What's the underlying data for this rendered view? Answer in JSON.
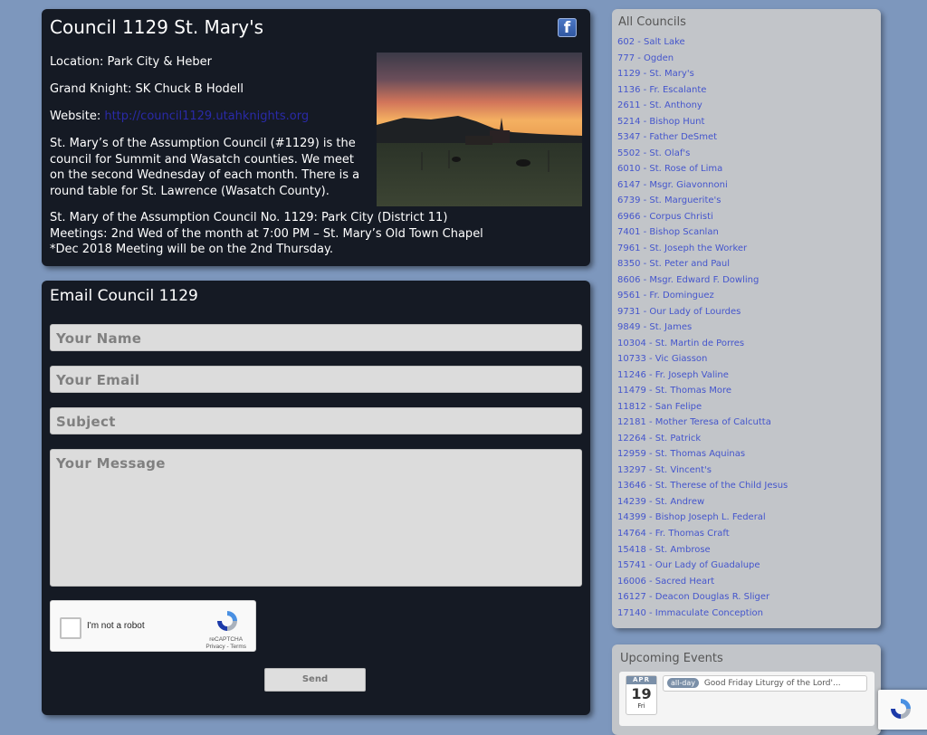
{
  "council": {
    "title": "Council 1129 St. Mary's",
    "location_label": "Location:",
    "location": "Park City & Heber",
    "gk_label": "Grand Knight:",
    "grand_knight": "SK Chuck B Hodell",
    "website_label": "Website:",
    "website": "http://council1129.utahknights.org",
    "description": "St. Mary’s of the Assumption Council (#1129) is the council for Summit and Wasatch counties. We meet on the second Wednesday of each month. There is a round table for St. Lawrence (Wasatch County).",
    "meeting_lines": [
      "St. Mary of the Assumption Council No. 1129:  Park City (District 11)",
      "Meetings: 2nd Wed of the month at 7:00 PM – St. Mary’s Old Town Chapel",
      "*Dec 2018 Meeting will be on the 2nd Thursday."
    ],
    "social_icon": "facebook-icon"
  },
  "form": {
    "title": "Email Council 1129",
    "name_placeholder": "Your Name",
    "email_placeholder": "Your Email",
    "subject_placeholder": "Subject",
    "message_placeholder": "Your Message",
    "captcha_label": "I'm not a robot",
    "captcha_brand": "reCAPTCHA",
    "captcha_links": "Privacy - Terms",
    "send_label": "Send"
  },
  "sidebar": {
    "title": "All Councils",
    "councils": [
      "602 - Salt Lake",
      "777 - Ogden",
      "1129 - St. Mary's",
      "1136 - Fr. Escalante",
      "2611 - St. Anthony",
      "5214 - Bishop Hunt",
      "5347 - Father DeSmet",
      "5502 - St. Olaf's",
      "6010 - St. Rose of Lima",
      "6147 - Msgr. Giavonnoni",
      "6739 - St. Marguerite's",
      "6966 - Corpus Christi",
      "7401 - Bishop Scanlan",
      "7961 - St. Joseph the Worker",
      "8350 - St. Peter and Paul",
      "8606 - Msgr. Edward F. Dowling",
      "9561 - Fr. Dominguez",
      "9731 - Our Lady of Lourdes",
      "9849 - St. James",
      "10304 - St. Martin de Porres",
      "10733 - Vic Giasson",
      "11246 - Fr. Joseph Valine",
      "11479 - St. Thomas More",
      "11812 - San Felipe",
      "12181 - Mother Teresa of Calcutta",
      "12264 - St. Patrick",
      "12959 - St. Thomas Aquinas",
      "13297 - St. Vincent's",
      "13646 - St. Therese of the Child Jesus",
      "14239 - St. Andrew",
      "14399 - Bishop Joseph L. Federal",
      "14764 - Fr. Thomas Craft",
      "15418 - St. Ambrose",
      "15741 - Our Lady of Guadalupe",
      "16006 - Sacred Heart",
      "16127 - Deacon Douglas R. Sliger",
      "17140 - Immaculate Conception"
    ]
  },
  "events": {
    "title": "Upcoming Events",
    "month": "APR",
    "day": "19",
    "weekday": "Fri",
    "badge": "all-day",
    "event_title": "Good Friday Liturgy of the Lord'..."
  }
}
